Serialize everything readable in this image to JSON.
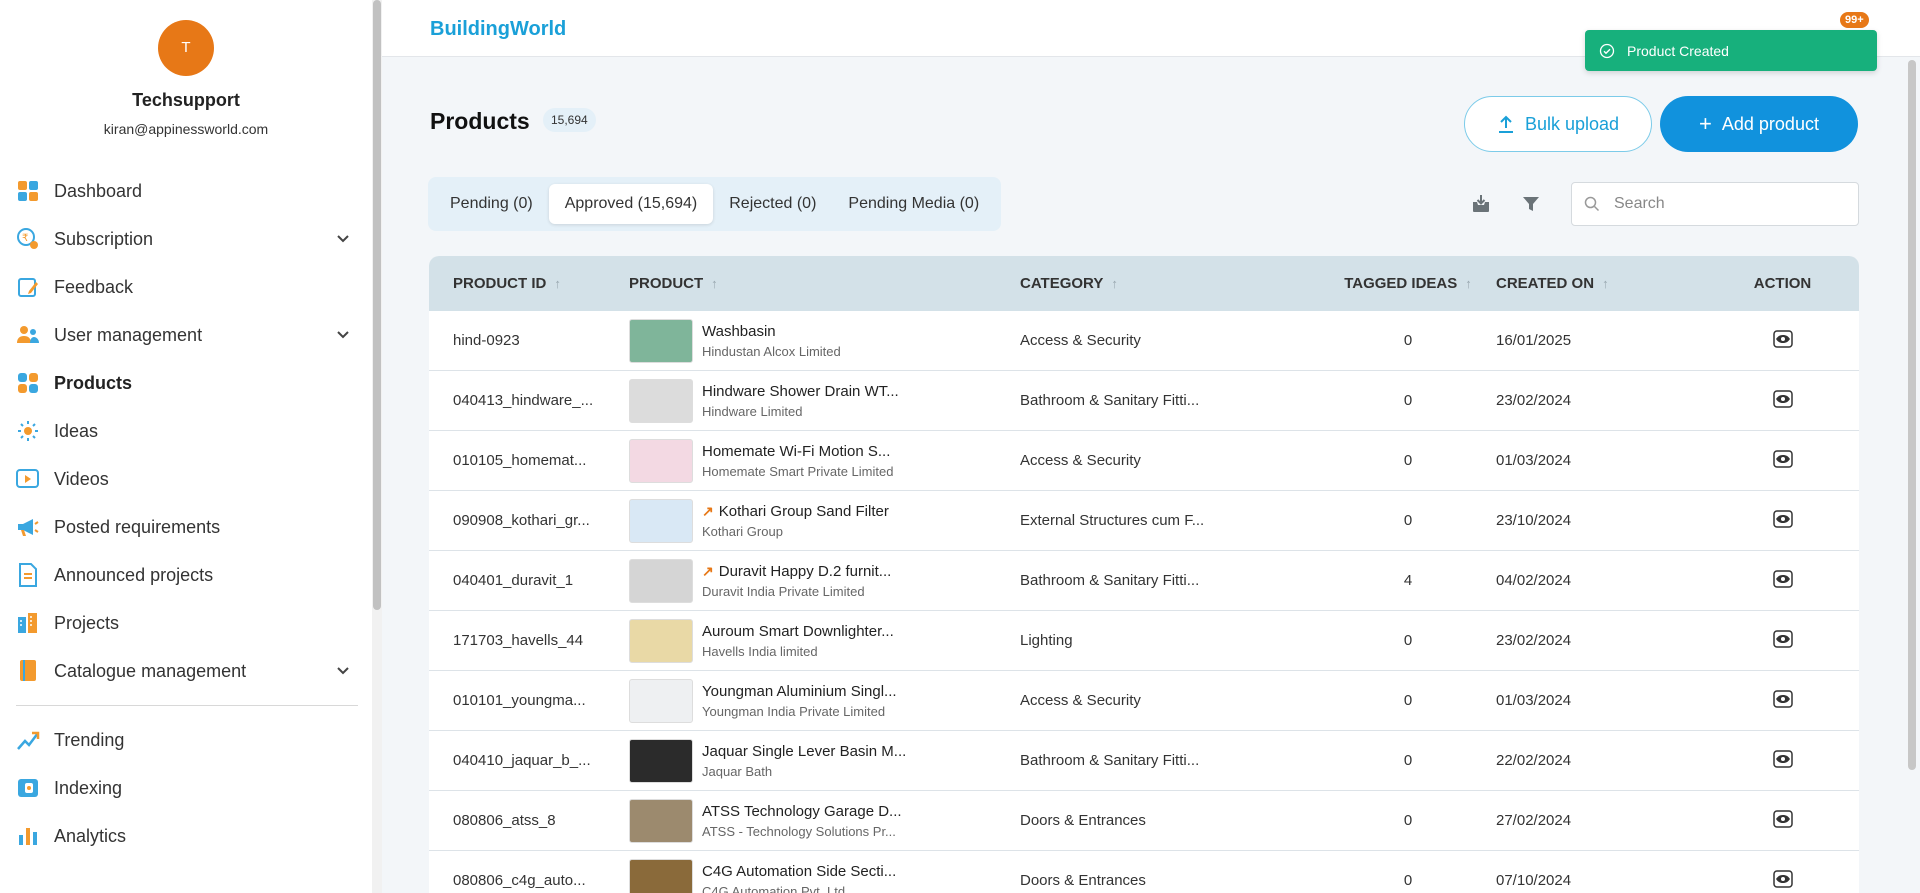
{
  "profile": {
    "initial": "T",
    "name": "Techsupport",
    "email": "kiran@appinessworld.com"
  },
  "nav": [
    {
      "label": "Dashboard",
      "icon": "dashboard-icon",
      "has_chevron": false
    },
    {
      "label": "Subscription",
      "icon": "subscription-icon",
      "has_chevron": true
    },
    {
      "label": "Feedback",
      "icon": "feedback-icon",
      "has_chevron": false
    },
    {
      "label": "User management",
      "icon": "users-icon",
      "has_chevron": true
    },
    {
      "label": "Products",
      "icon": "products-icon",
      "has_chevron": false,
      "active": true
    },
    {
      "label": "Ideas",
      "icon": "ideas-icon",
      "has_chevron": false
    },
    {
      "label": "Videos",
      "icon": "videos-icon",
      "has_chevron": false
    },
    {
      "label": "Posted requirements",
      "icon": "megaphone-icon",
      "has_chevron": false
    },
    {
      "label": "Announced projects",
      "icon": "document-icon",
      "has_chevron": false
    },
    {
      "label": "Projects",
      "icon": "buildings-icon",
      "has_chevron": false
    },
    {
      "label": "Catalogue management",
      "icon": "catalogue-icon",
      "has_chevron": true
    }
  ],
  "nav2": [
    {
      "label": "Trending",
      "icon": "trending-icon"
    },
    {
      "label": "Indexing",
      "icon": "indexing-icon"
    },
    {
      "label": "Analytics",
      "icon": "analytics-icon"
    }
  ],
  "header": {
    "brand": "BuildingWorld",
    "notification_count": "99+"
  },
  "toast": {
    "message": "Product Created"
  },
  "page": {
    "title": "Products",
    "count": "15,694"
  },
  "actions": {
    "bulk_upload": "Bulk upload",
    "add_product": "Add product"
  },
  "tabs": [
    {
      "label": "Pending (0)",
      "active": false
    },
    {
      "label": "Approved (15,694)",
      "active": true
    },
    {
      "label": "Rejected (0)",
      "active": false
    },
    {
      "label": "Pending Media (0)",
      "active": false
    }
  ],
  "search": {
    "placeholder": "Search"
  },
  "table": {
    "columns": [
      "PRODUCT ID",
      "PRODUCT",
      "CATEGORY",
      "TAGGED IDEAS",
      "CREATED ON",
      "ACTION"
    ],
    "rows": [
      {
        "id": "hind-0923",
        "name": "Washbasin",
        "company": "Hindustan Alcox Limited",
        "category": "Access & Security",
        "tagged": "0",
        "created": "16/01/2025",
        "trending": false,
        "thumb": "#7fb59a"
      },
      {
        "id": "040413_hindware_...",
        "name": "Hindware Shower Drain WT...",
        "company": "Hindware Limited",
        "category": "Bathroom & Sanitary Fitti...",
        "tagged": "0",
        "created": "23/02/2024",
        "trending": false,
        "thumb": "#dcdcdc"
      },
      {
        "id": "010105_homemat...",
        "name": "Homemate Wi-Fi Motion S...",
        "company": "Homemate Smart Private Limited",
        "category": "Access & Security",
        "tagged": "0",
        "created": "01/03/2024",
        "trending": false,
        "thumb": "#f3d9e3"
      },
      {
        "id": "090908_kothari_gr...",
        "name": "Kothari Group Sand Filter",
        "company": "Kothari Group",
        "category": "External Structures cum F...",
        "tagged": "0",
        "created": "23/10/2024",
        "trending": true,
        "thumb": "#d9e8f5"
      },
      {
        "id": "040401_duravit_1",
        "name": "Duravit Happy D.2 furnit...",
        "company": "Duravit India Private Limited",
        "category": "Bathroom & Sanitary Fitti...",
        "tagged": "4",
        "created": "04/02/2024",
        "trending": true,
        "thumb": "#d5d5d5"
      },
      {
        "id": "171703_havells_44",
        "name": "Auroum Smart Downlighter...",
        "company": "Havells India limited",
        "category": "Lighting",
        "tagged": "0",
        "created": "23/02/2024",
        "trending": false,
        "thumb": "#e9d9a6"
      },
      {
        "id": "010101_youngma...",
        "name": "Youngman Aluminium Singl...",
        "company": "Youngman India Private Limited",
        "category": "Access & Security",
        "tagged": "0",
        "created": "01/03/2024",
        "trending": false,
        "thumb": "#eef0f2"
      },
      {
        "id": "040410_jaquar_b_...",
        "name": "Jaquar Single Lever Basin M...",
        "company": "Jaquar Bath",
        "category": "Bathroom & Sanitary Fitti...",
        "tagged": "0",
        "created": "22/02/2024",
        "trending": false,
        "thumb": "#2b2b2b"
      },
      {
        "id": "080806_atss_8",
        "name": "ATSS Technology Garage D...",
        "company": "ATSS - Technology Solutions Pr...",
        "category": "Doors & Entrances",
        "tagged": "0",
        "created": "27/02/2024",
        "trending": false,
        "thumb": "#9c8a6e"
      },
      {
        "id": "080806_c4g_auto...",
        "name": "C4G Automation Side Secti...",
        "company": "C4G Automation Pvt. Ltd.",
        "category": "Doors & Entrances",
        "tagged": "0",
        "created": "07/10/2024",
        "trending": false,
        "thumb": "#8a6a3a"
      }
    ]
  },
  "colors": {
    "brand": "#1aa0d8",
    "primary": "#1192dd",
    "toast": "#17b07c",
    "avatar": "#e77817"
  }
}
